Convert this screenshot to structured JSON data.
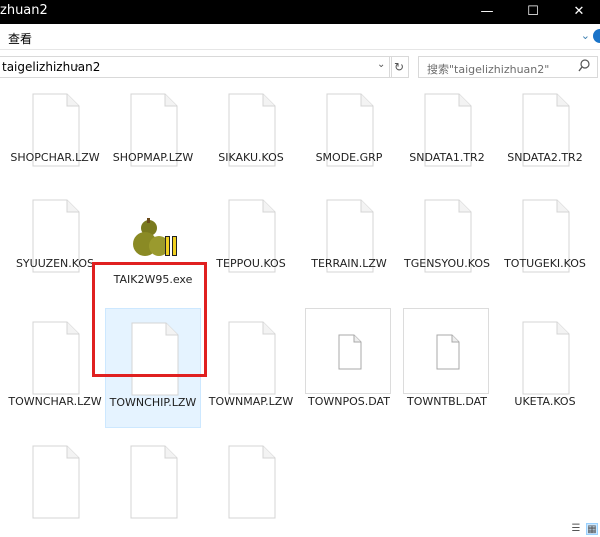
{
  "window": {
    "title": "zhuan2",
    "minimize_glyph": "—",
    "maximize_glyph": "☐",
    "close_glyph": "✕"
  },
  "ribbon": {
    "tab_label": "查看",
    "expand_glyph": "⌄"
  },
  "address": {
    "path": "taigelizhizhuan2",
    "separator": "›",
    "dropdown_glyph": "⌄",
    "refresh_glyph": "↻"
  },
  "search": {
    "placeholder": "搜索\"taigelizhizhuan2\"",
    "icon": "search-icon"
  },
  "files": [
    {
      "name": "SHOPCHAR.LZW",
      "icon": "blank-file-icon"
    },
    {
      "name": "SHOPMAP.LZW",
      "icon": "blank-file-icon"
    },
    {
      "name": "SIKAKU.KOS",
      "icon": "blank-file-icon"
    },
    {
      "name": "SMODE.GRP",
      "icon": "blank-file-icon"
    },
    {
      "name": "SNDATA1.TR2",
      "icon": "blank-file-icon"
    },
    {
      "name": "SNDATA2.TR2",
      "icon": "blank-file-icon"
    },
    {
      "name": "SYUUZEN.KOS",
      "icon": "blank-file-icon"
    },
    {
      "name": "TAIK2W95.exe",
      "icon": "gourd-app-icon"
    },
    {
      "name": "TEPPOU.KOS",
      "icon": "blank-file-icon"
    },
    {
      "name": "TERRAIN.LZW",
      "icon": "blank-file-icon"
    },
    {
      "name": "TGENSYOU.KOS",
      "icon": "blank-file-icon"
    },
    {
      "name": "TOTUGEKI.KOS",
      "icon": "blank-file-icon"
    },
    {
      "name": "TOWNCHAR.LZW",
      "icon": "blank-file-icon"
    },
    {
      "name": "TOWNCHIP.LZW",
      "icon": "blank-file-icon",
      "selected": true
    },
    {
      "name": "TOWNMAP.LZW",
      "icon": "blank-file-icon"
    },
    {
      "name": "TOWNPOS.DAT",
      "icon": "small-file-icon"
    },
    {
      "name": "TOWNTBL.DAT",
      "icon": "small-file-icon"
    },
    {
      "name": "UKETA.KOS",
      "icon": "blank-file-icon"
    },
    {
      "name": "",
      "icon": "blank-file-icon"
    },
    {
      "name": "",
      "icon": "blank-file-icon"
    },
    {
      "name": "",
      "icon": "blank-file-icon"
    }
  ],
  "statusbar": {
    "details_view_glyph": "☰",
    "icons_view_glyph": "▦"
  },
  "colors": {
    "highlight": "#e02020",
    "selection": "#e5f3ff",
    "accent": "#3c7fb1"
  }
}
